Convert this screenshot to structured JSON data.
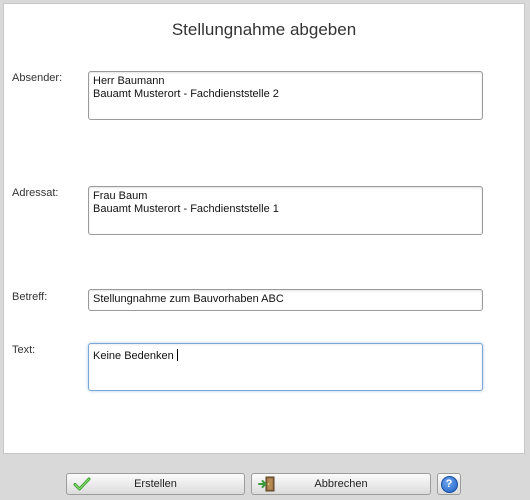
{
  "dialog": {
    "title": "Stellungnahme abgeben"
  },
  "form": {
    "absender": {
      "label": "Absender:",
      "lines": [
        "Herr Baumann",
        "Bauamt Musterort - Fachdienststelle 2"
      ]
    },
    "adressat": {
      "label": "Adressat:",
      "lines": [
        "Frau Baum",
        "Bauamt Musterort - Fachdienststelle 1"
      ]
    },
    "betreff": {
      "label": "Betreff:",
      "value": "Stellungnahme zum Bauvorhaben ABC"
    },
    "text": {
      "label": "Text:",
      "value": "Keine Bedenken"
    }
  },
  "footer": {
    "create_label": "Erstellen",
    "create_icon": "checkmark-icon",
    "cancel_label": "Abbrechen",
    "cancel_icon": "exit-door-icon",
    "help_label": "?",
    "help_icon": "help-icon"
  }
}
